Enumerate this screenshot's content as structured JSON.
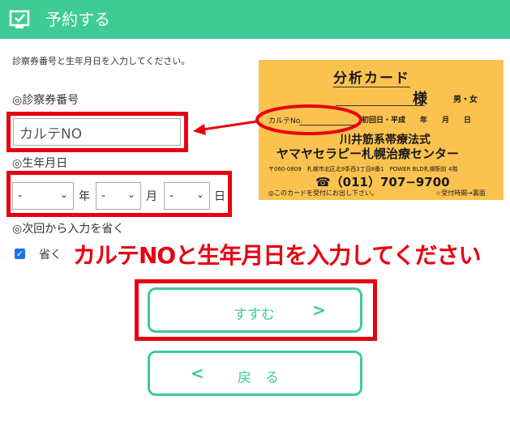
{
  "header": {
    "title": "予約する",
    "icon": "calendar-check-icon"
  },
  "instruction": "診察券番号と生年月日を入力してください。",
  "patient_number": {
    "label": "◎診察券番号",
    "placeholder": "カルテNO"
  },
  "birth_date": {
    "label": "◎生年月日",
    "year": "-",
    "month": "-",
    "day": "-",
    "year_unit": "年",
    "month_unit": "月",
    "day_unit": "日"
  },
  "skip": {
    "label": "◎次回から入力を省く",
    "checkbox_label": "省く",
    "checked": true
  },
  "annotation": "カルテNOと生年月日を入力してください",
  "buttons": {
    "next": "すすむ",
    "back": "戻　る"
  },
  "card": {
    "title": "分析カード",
    "sama": "様",
    "gender": "男・女",
    "karte_label": "カルテNo.",
    "first_visit": "初回日・平成　　年　　月　　日",
    "line1": "川井筋系帯療法式",
    "line2": "ヤマヤセラピー札幌治療センター",
    "address": "〒060-0809　札幌市北区北9条西3丁目8番1　POWER BLD札幌駅前 4階",
    "phone": "☎（011）707−9700",
    "note_left": "◎このカードを受付にお出し下さい。",
    "note_right": "☆受付時間→裏面"
  },
  "colors": {
    "accent": "#3fcb96",
    "highlight": "#e60012",
    "card": "#fbc24f"
  }
}
